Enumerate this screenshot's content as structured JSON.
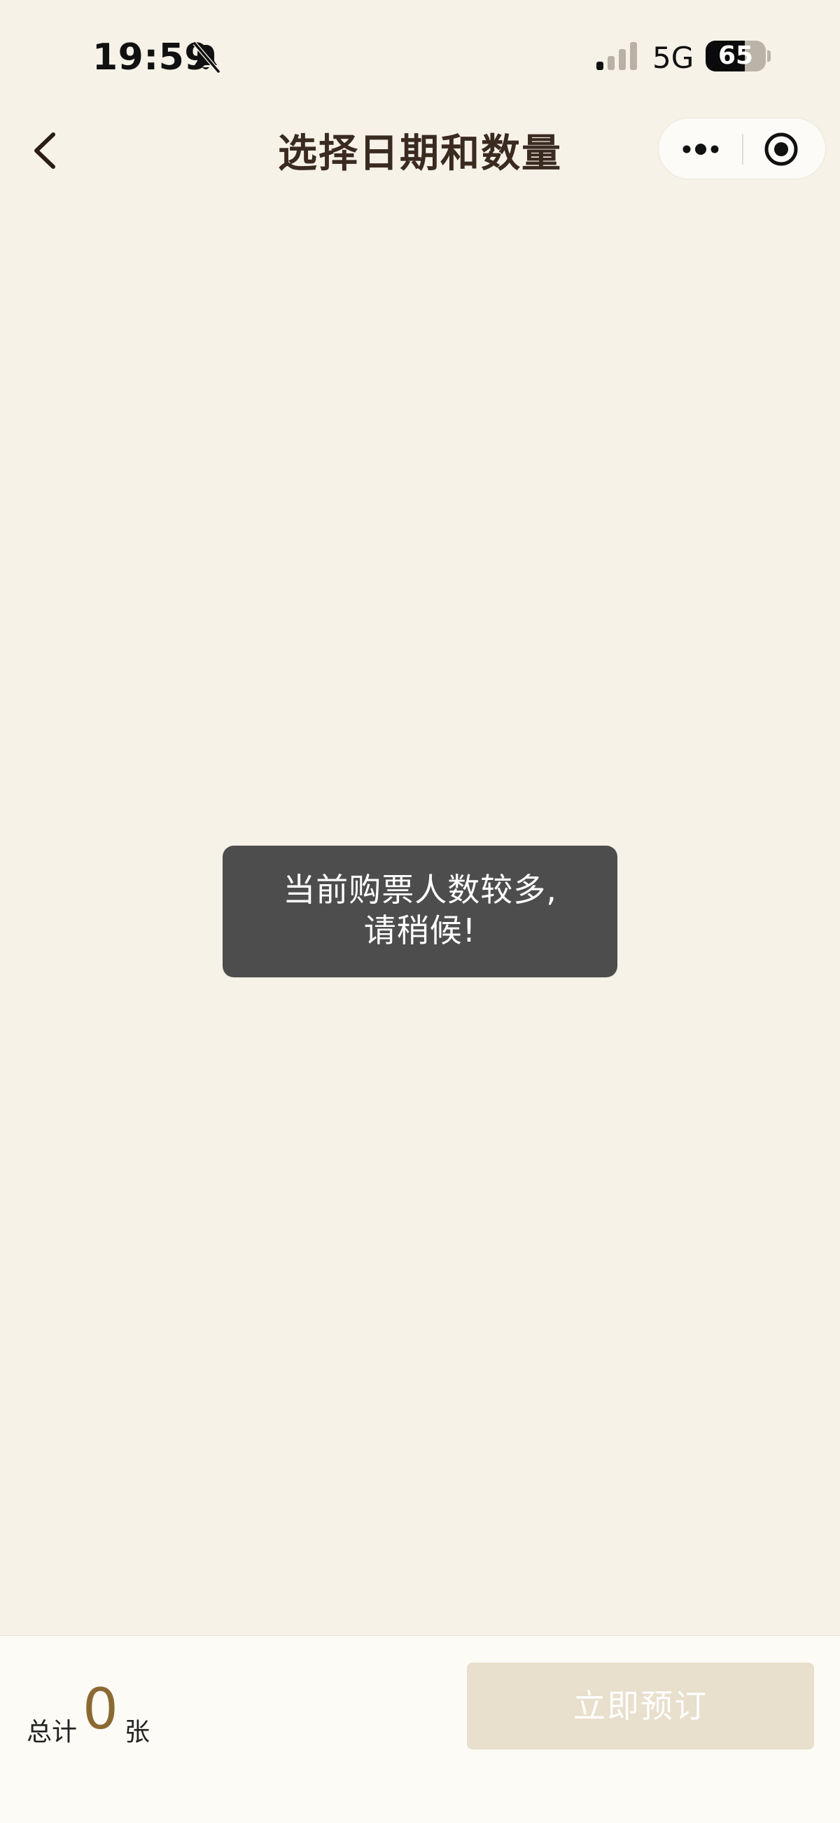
{
  "status_bar": {
    "time": "19:59",
    "network": "5G",
    "battery_level": "65",
    "battery_fraction": 0.65,
    "icons": [
      "bell-off-icon",
      "signal-icon",
      "battery-icon"
    ]
  },
  "nav": {
    "title": "选择日期和数量",
    "back_icon": "chevron-left-icon",
    "more_icon": "more-dots-icon",
    "close_icon": "target-circle-icon"
  },
  "toast": {
    "line1": "当前购票人数较多,",
    "line2": "请稍候!"
  },
  "footer": {
    "total_label": "总计",
    "total_count": "0",
    "total_unit": "张",
    "book_button": "立即预订"
  },
  "colors": {
    "background": "#f6f2e8",
    "title": "#3a2a20",
    "accent": "#8b6a32",
    "button_disabled": "#e8dfcc",
    "toast_bg": "#4d4d4d"
  }
}
